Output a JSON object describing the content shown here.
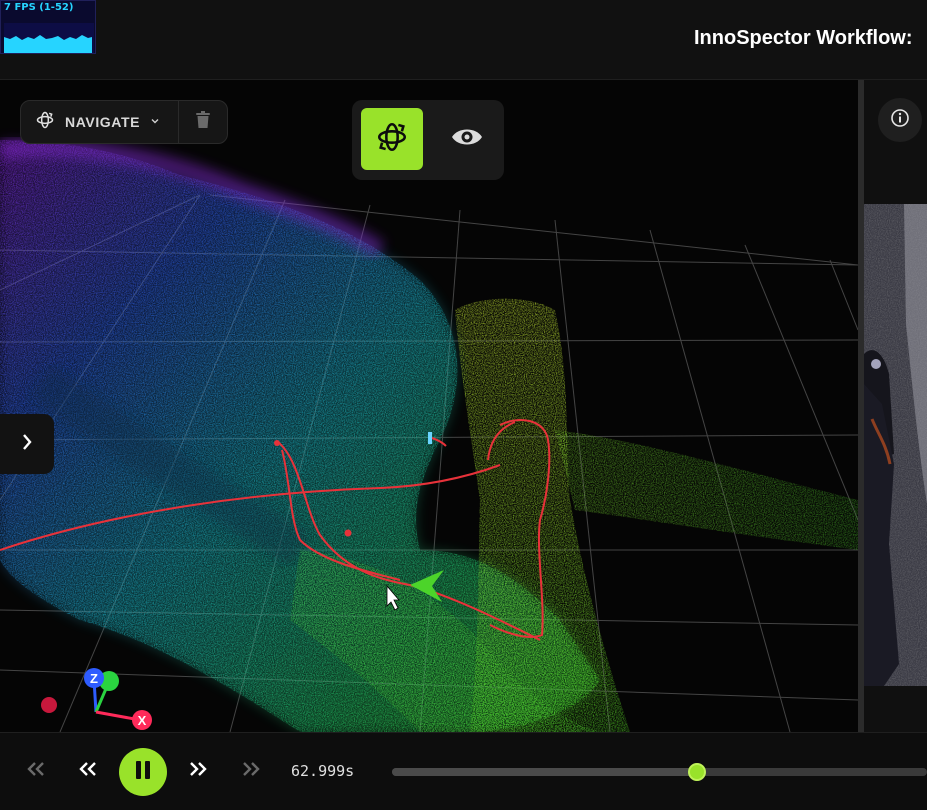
{
  "header": {
    "fps_label": "7 FPS (1-52)",
    "app_title": "InnoSpector Workflow:"
  },
  "toolbar": {
    "mode_label": "NAVIGATE",
    "mode_icon": "orbit-icon",
    "delete_icon": "trash-icon"
  },
  "view_modes": [
    {
      "name": "orbit",
      "icon": "orbit-icon",
      "active": true
    },
    {
      "name": "view",
      "icon": "eye-icon",
      "active": false
    }
  ],
  "gizmo": {
    "z_label": "Z",
    "x_label": "X"
  },
  "playback": {
    "time": "62.999s",
    "progress": 0.57
  },
  "colors": {
    "accent": "#99e22a",
    "trajectory": "#e8323a",
    "background": "#050505"
  }
}
